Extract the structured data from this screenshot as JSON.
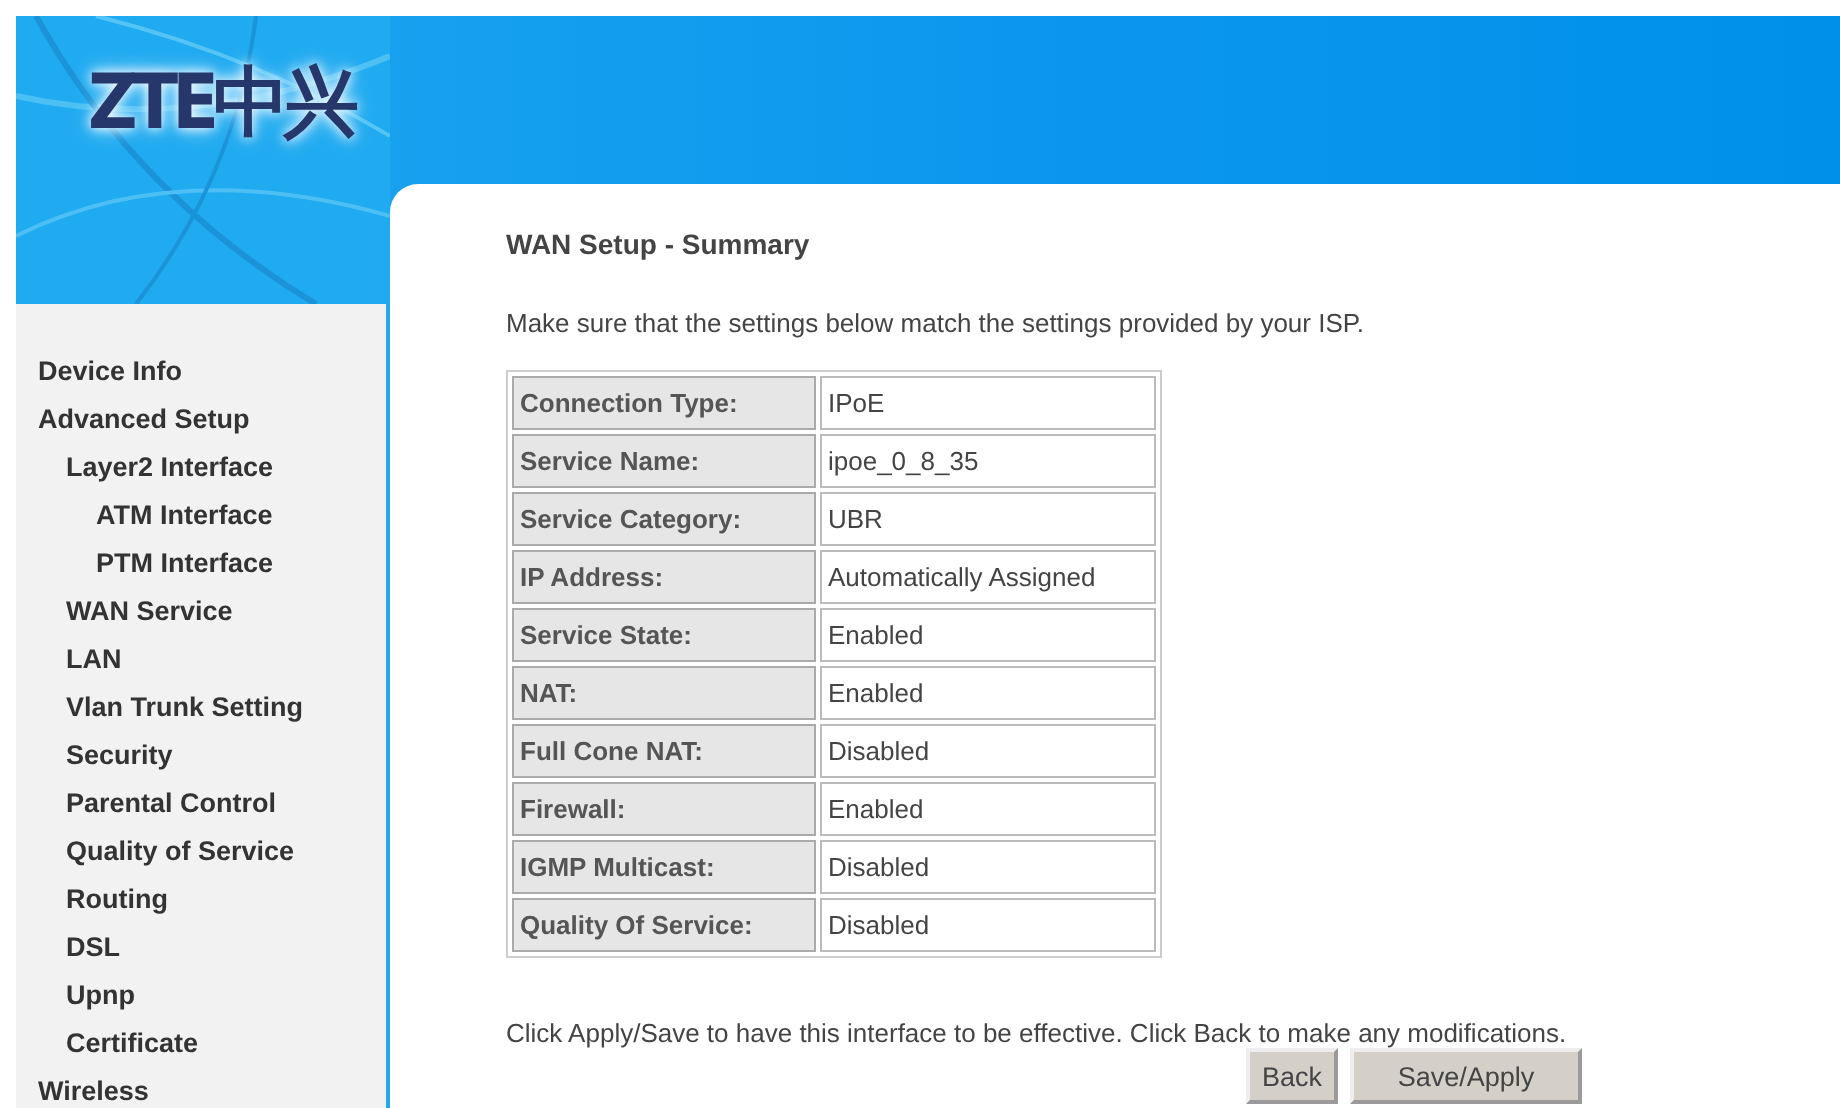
{
  "logo": {
    "text": "ZTE中兴"
  },
  "nav": [
    {
      "label": "Device Info"
    },
    {
      "label": "Advanced Setup",
      "children": [
        {
          "label": "Layer2 Interface",
          "children": [
            {
              "label": "ATM Interface"
            },
            {
              "label": "PTM Interface"
            }
          ]
        },
        {
          "label": "WAN Service"
        },
        {
          "label": "LAN"
        },
        {
          "label": "Vlan Trunk Setting"
        },
        {
          "label": "Security"
        },
        {
          "label": "Parental Control"
        },
        {
          "label": "Quality of Service"
        },
        {
          "label": "Routing"
        },
        {
          "label": "DSL"
        },
        {
          "label": "Upnp"
        },
        {
          "label": "Certificate"
        }
      ]
    },
    {
      "label": "Wireless"
    }
  ],
  "page": {
    "title": "WAN Setup - Summary",
    "intro": "Make sure that the settings below match the settings provided by your ISP.",
    "summary": [
      {
        "label": "Connection Type:",
        "value": "IPoE"
      },
      {
        "label": "Service Name:",
        "value": "ipoe_0_8_35"
      },
      {
        "label": "Service Category:",
        "value": "UBR"
      },
      {
        "label": "IP Address:",
        "value": "Automatically Assigned"
      },
      {
        "label": "Service State:",
        "value": "Enabled"
      },
      {
        "label": "NAT:",
        "value": "Enabled"
      },
      {
        "label": "Full Cone NAT:",
        "value": "Disabled"
      },
      {
        "label": "Firewall:",
        "value": "Enabled"
      },
      {
        "label": "IGMP Multicast:",
        "value": "Disabled"
      },
      {
        "label": "Quality Of Service:",
        "value": "Disabled"
      }
    ],
    "note": "Click Apply/Save to have this interface to be effective. Click Back to make any modifications.",
    "buttons": [
      "Back",
      "Save/Apply"
    ]
  }
}
